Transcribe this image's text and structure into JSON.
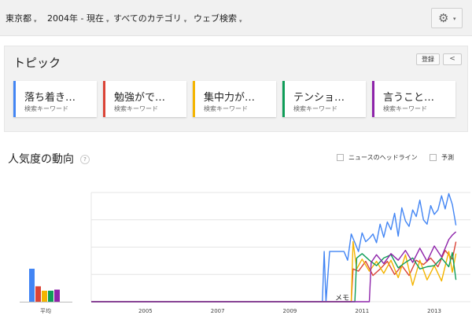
{
  "filters": {
    "region": "東京都",
    "period": "2004年 - 現在",
    "category": "すべてのカテゴリ",
    "search_type": "ウェブ検索"
  },
  "topics": {
    "title": "トピック",
    "login_label": "登録",
    "cards": [
      {
        "name": "落ち着き…",
        "type": "検索キーワード",
        "color": "#4285f4"
      },
      {
        "name": "勉強がで…",
        "type": "検索キーワード",
        "color": "#db4437"
      },
      {
        "name": "集中力が…",
        "type": "検索キーワード",
        "color": "#f4b400"
      },
      {
        "name": "テンショ…",
        "type": "検索キーワード",
        "color": "#0f9d58"
      },
      {
        "name": "言うこと…",
        "type": "検索キーワード",
        "color": "#8e24aa"
      }
    ]
  },
  "interest": {
    "title": "人気度の動向",
    "help": "?",
    "news_label": "ニュースのヘッドライン",
    "forecast_label": "予測",
    "average_label": "平均",
    "memo_label": "メモ"
  },
  "icons": {
    "gear": "gear-icon",
    "share": "share-icon",
    "dropdown": "chevron-down-icon"
  },
  "chart_data": {
    "type": "line",
    "title": "",
    "xlabel": "",
    "ylabel": "",
    "x_tick_labels": [
      "2005",
      "2007",
      "2009",
      "2011",
      "2013"
    ],
    "x_range": [
      2004.0,
      2014.5
    ],
    "ylim": [
      0,
      100
    ],
    "grid": true,
    "averages": [
      {
        "color": "#4285f4",
        "value": 30
      },
      {
        "color": "#db4437",
        "value": 14
      },
      {
        "color": "#f4b400",
        "value": 10
      },
      {
        "color": "#0f9d58",
        "value": 10
      },
      {
        "color": "#8e24aa",
        "value": 11
      }
    ],
    "series": [
      {
        "color": "#4285f4",
        "x": [
          2004.0,
          2010.4,
          2010.45,
          2010.5,
          2010.6,
          2010.7,
          2010.8,
          2010.9,
          2011.0,
          2011.1,
          2011.2,
          2011.3,
          2011.4,
          2011.5,
          2011.6,
          2011.7,
          2011.8,
          2011.9,
          2012.0,
          2012.1,
          2012.2,
          2012.3,
          2012.4,
          2012.5,
          2012.6,
          2012.7,
          2012.8,
          2012.9,
          2013.0,
          2013.1,
          2013.2,
          2013.3,
          2013.4,
          2013.5,
          2013.6,
          2013.7,
          2013.8,
          2013.9,
          2014.0,
          2014.1
        ],
        "y": [
          0,
          0,
          46,
          0,
          46,
          46,
          46,
          46,
          46,
          38,
          62,
          54,
          46,
          63,
          55,
          58,
          62,
          54,
          71,
          59,
          73,
          66,
          81,
          60,
          86,
          74,
          69,
          84,
          78,
          93,
          75,
          71,
          88,
          80,
          84,
          97,
          85,
          99,
          89,
          70
        ]
      },
      {
        "color": "#db4437",
        "x": [
          2004.0,
          2011.2,
          2011.25,
          2011.4,
          2011.6,
          2011.8,
          2012.0,
          2012.2,
          2012.4,
          2012.6,
          2012.8,
          2013.0,
          2013.2,
          2013.4,
          2013.6,
          2013.8,
          2014.0,
          2014.1
        ],
        "y": [
          0,
          0,
          30,
          28,
          37,
          24,
          30,
          37,
          25,
          33,
          24,
          38,
          34,
          40,
          32,
          47,
          39,
          55
        ]
      },
      {
        "color": "#f4b400",
        "x": [
          2004.0,
          2011.2,
          2011.25,
          2011.35,
          2011.5,
          2011.7,
          2011.9,
          2012.1,
          2012.3,
          2012.5,
          2012.7,
          2012.9,
          2013.1,
          2013.3,
          2013.5,
          2013.7,
          2013.9,
          2014.0,
          2014.1
        ],
        "y": [
          0,
          0,
          55,
          30,
          39,
          28,
          37,
          26,
          38,
          22,
          43,
          15,
          38,
          20,
          33,
          19,
          46,
          27,
          44
        ]
      },
      {
        "color": "#0f9d58",
        "x": [
          2004.0,
          2011.3,
          2011.35,
          2011.5,
          2011.7,
          2011.9,
          2012.1,
          2012.3,
          2012.5,
          2012.7,
          2012.9,
          2013.1,
          2013.3,
          2013.5,
          2013.7,
          2013.9,
          2014.0,
          2014.1
        ],
        "y": [
          0,
          0,
          40,
          44,
          38,
          33,
          40,
          43,
          31,
          36,
          40,
          30,
          32,
          33,
          40,
          32,
          45,
          20
        ]
      },
      {
        "color": "#8e24aa",
        "x": [
          2004.0,
          2011.4,
          2011.7,
          2011.75,
          2011.9,
          2012.1,
          2012.3,
          2012.5,
          2012.7,
          2012.9,
          2013.1,
          2013.3,
          2013.5,
          2013.7,
          2013.9,
          2014.0,
          2014.1
        ],
        "y": [
          0,
          0,
          0,
          36,
          43,
          35,
          44,
          38,
          47,
          36,
          49,
          37,
          51,
          41,
          57,
          61,
          64
        ]
      }
    ]
  }
}
